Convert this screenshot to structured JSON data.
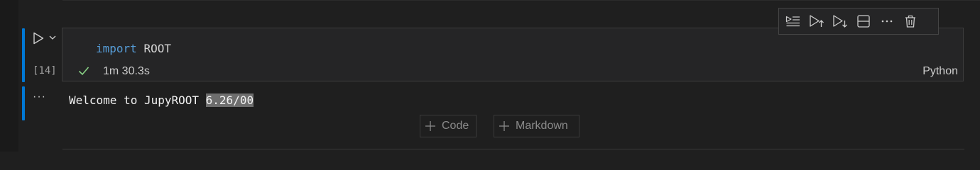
{
  "cell": {
    "code": {
      "keyword": "import",
      "module": "ROOT"
    },
    "execution_count": "[14]",
    "status_time": "1m 30.3s",
    "language": "Python"
  },
  "output": {
    "more_label": "···",
    "text_prefix": "Welcome to JupyROOT ",
    "version_highlight": "6.26/00"
  },
  "add_buttons": {
    "code_label": "Code",
    "markdown_label": "Markdown"
  },
  "toolbar": {
    "icons": [
      "run-by-line-icon",
      "execute-above-icon",
      "execute-below-icon",
      "split-cell-icon",
      "more-actions-icon",
      "delete-icon"
    ],
    "more_label": "···"
  },
  "colors": {
    "focus_accent": "#0078d4",
    "keyword": "#569cd6",
    "success_check": "#89d185",
    "highlight": "#6e6e6e"
  }
}
